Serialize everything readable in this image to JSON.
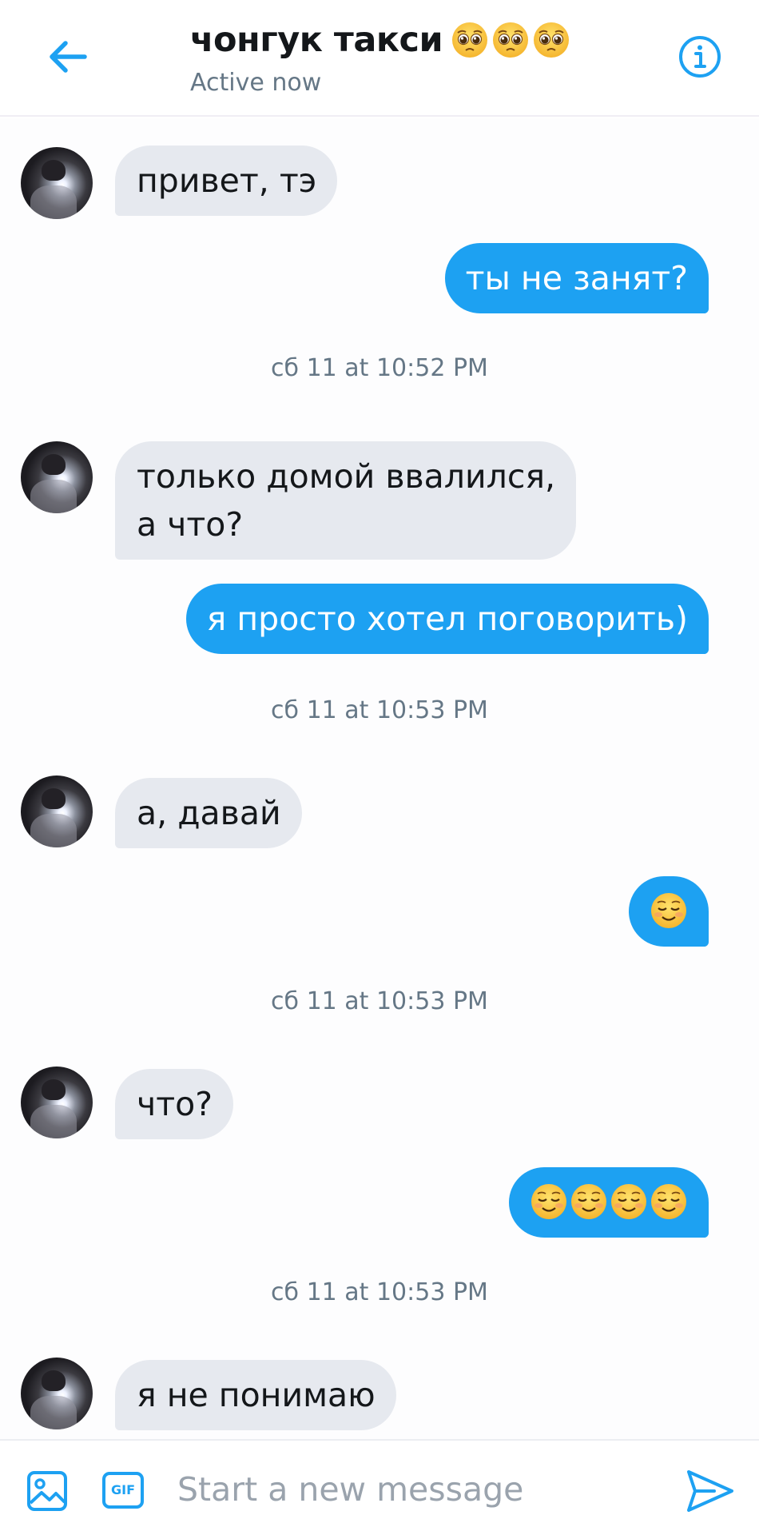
{
  "header": {
    "title": "чонгук такси",
    "title_emojis": [
      "pleading-face",
      "pleading-face",
      "pleading-face"
    ],
    "status": "Active now"
  },
  "messages": [
    {
      "side": "in",
      "text": "привет, тэ"
    },
    {
      "side": "out",
      "text": "ты не занят?"
    },
    {
      "side": "time",
      "text": "сб 11 at 10:52 PM"
    },
    {
      "side": "in",
      "text": "только домой ввалился,\nа что?"
    },
    {
      "side": "out",
      "text": "я просто хотел поговорить)"
    },
    {
      "side": "time",
      "text": "сб 11 at 10:53 PM"
    },
    {
      "side": "in",
      "text": "а, давай"
    },
    {
      "side": "out",
      "emoji": "smiling-face",
      "emoji_count": 1
    },
    {
      "side": "time",
      "text": "сб 11 at 10:53 PM"
    },
    {
      "side": "in",
      "text": "что?"
    },
    {
      "side": "out",
      "emoji": "smiling-face",
      "emoji_count": 4
    },
    {
      "side": "time",
      "text": "сб 11 at 10:53 PM"
    },
    {
      "side": "in",
      "text": "я не понимаю"
    }
  ],
  "composer": {
    "placeholder": "Start a new message",
    "gif_label": "GIF"
  },
  "colors": {
    "accent": "#1da1f2",
    "incoming_bubble": "#e6e9ef",
    "secondary_text": "#657786"
  }
}
